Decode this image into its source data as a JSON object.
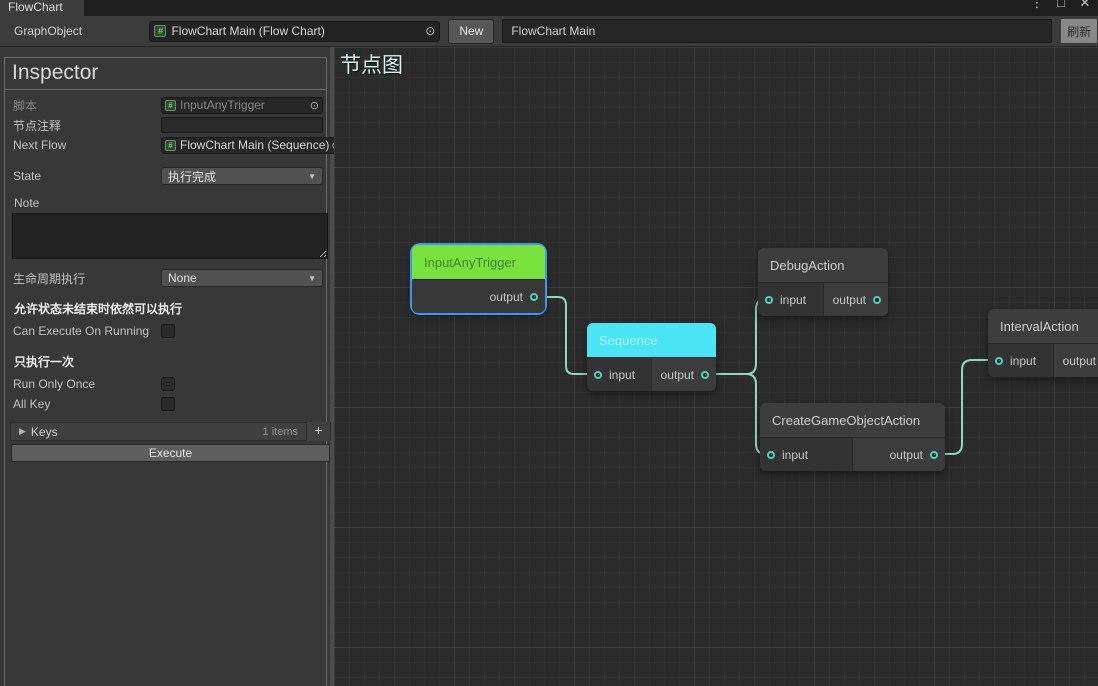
{
  "colors": {
    "selection": "#3e96f0",
    "wire": "#8fd8c2",
    "port": "#4dd4c2",
    "green": "#78e13c",
    "cyan": "#4be4f4"
  },
  "window": {
    "tab_title": "FlowChart",
    "controls": {
      "menu": "⋮",
      "maximize": "□",
      "close": "✕"
    },
    "toolbar": {
      "graph_object_label": "GraphObject",
      "graph_object_value": "FlowChart Main (Flow Chart)",
      "object_icon_glyph": "#",
      "picker_glyph": "⊙",
      "new_button": "New",
      "graph_name_value": "FlowChart Main",
      "refresh_button": "刷新"
    }
  },
  "inspector": {
    "title": "Inspector",
    "script_label": "脚本",
    "script_value": "InputAnyTrigger",
    "comment_label": "节点注释",
    "comment_value": "",
    "next_flow_label": "Next Flow",
    "next_flow_value": "FlowChart Main (Sequence)",
    "state_label": "State",
    "state_value": "执行完成",
    "dropdown_arrow": "▼",
    "note_label": "Note",
    "note_value": "",
    "lifecycle_label": "生命周期执行",
    "lifecycle_value": "None",
    "can_execute_header": "允许状态未结束时依然可以执行",
    "can_execute_label": "Can Execute On Running",
    "run_once_header": "只执行一次",
    "run_once_label": "Run Only Once",
    "all_key_label": "All Key",
    "keys_fold_glyph": "▶",
    "keys_label": "Keys",
    "keys_count": "1 items",
    "keys_add_glyph": "+",
    "execute_button": "Execute"
  },
  "graph": {
    "title": "节点图",
    "nodes": [
      {
        "id": "input-any-trigger",
        "title": "InputAnyTrigger",
        "selected": true,
        "header_color": "green",
        "ports": [
          {
            "label": "output",
            "direction": "out",
            "connected": true
          }
        ]
      },
      {
        "id": "sequence",
        "title": "Sequence",
        "header_color": "cyan",
        "ports": [
          {
            "label": "input",
            "direction": "in",
            "connected": true
          },
          {
            "label": "output",
            "direction": "out",
            "connected": true
          }
        ]
      },
      {
        "id": "debug-action",
        "title": "DebugAction",
        "header_color": "gray",
        "ports": [
          {
            "label": "input",
            "direction": "in",
            "connected": true
          },
          {
            "label": "output",
            "direction": "out",
            "connected": false
          }
        ]
      },
      {
        "id": "create-game-object-action",
        "title": "CreateGameObjectAction",
        "header_color": "gray",
        "ports": [
          {
            "label": "input",
            "direction": "in",
            "connected": true
          },
          {
            "label": "output",
            "direction": "out",
            "connected": true
          }
        ]
      },
      {
        "id": "interval-action",
        "title": "IntervalAction",
        "header_color": "gray",
        "ports": [
          {
            "label": "input",
            "direction": "in",
            "connected": true
          },
          {
            "label": "output",
            "direction": "out",
            "connected": true
          }
        ]
      }
    ],
    "edges": [
      {
        "from": "InputAnyTrigger.output",
        "to": "Sequence.input"
      },
      {
        "from": "Sequence.output",
        "to": "DebugAction.input"
      },
      {
        "from": "Sequence.output",
        "to": "CreateGameObjectAction.input"
      },
      {
        "from": "CreateGameObjectAction.output",
        "to": "IntervalAction.input"
      }
    ]
  }
}
